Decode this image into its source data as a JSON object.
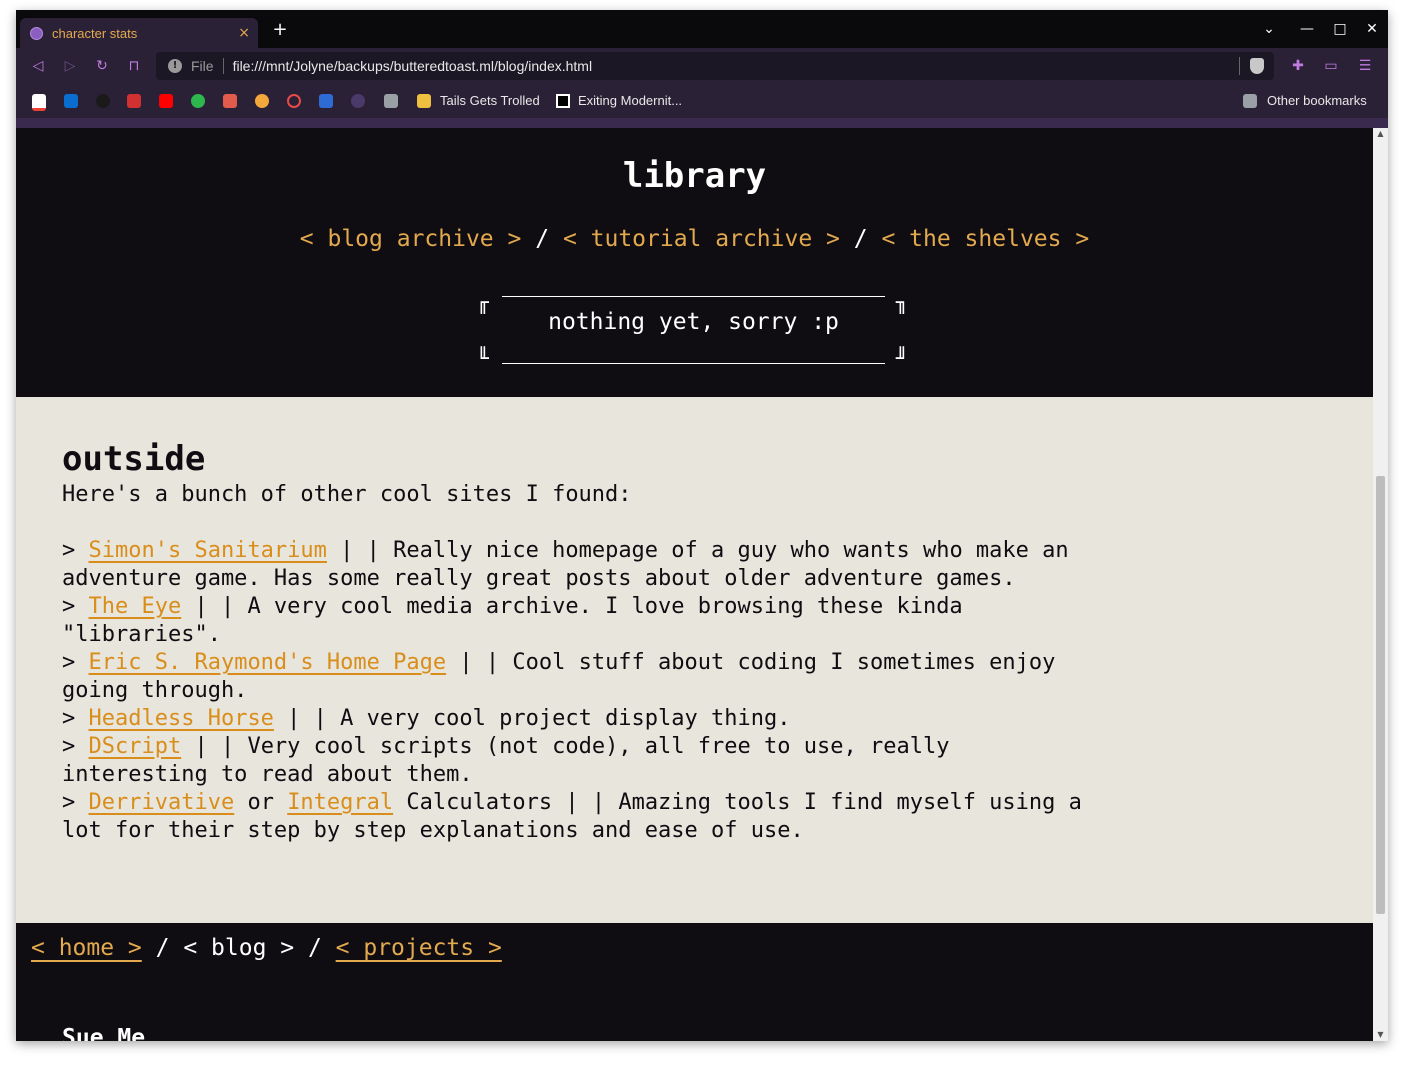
{
  "browser": {
    "tab_title": "character stats",
    "tab_close": "×",
    "new_tab": "+",
    "window": {
      "tab_search": "⌄",
      "minimize": "—",
      "maximize": "□",
      "close": "✕"
    },
    "url_scheme": "File",
    "url": "file:///mnt/Jolyne/backups/butteredtoast.ml/blog/index.html",
    "bookmarks": [
      {
        "label": "Tails Gets Trolled"
      },
      {
        "label": "Exiting Modernit..."
      },
      {
        "label": "Other bookmarks"
      }
    ],
    "accent_color": "#c07be0"
  },
  "hero": {
    "title": "library",
    "nav": [
      {
        "label": "< blog archive >"
      },
      {
        "label": "< tutorial archive >"
      },
      {
        "label": "< the shelves >"
      }
    ],
    "separator": "/",
    "box_text": "nothing yet, sorry :p",
    "corners": {
      "tl": "╓",
      "tr": "╖",
      "bl": "╙",
      "br": "╜"
    }
  },
  "outside": {
    "heading": "outside",
    "intro": "Here's a bunch of other cool sites I found:",
    "entries": [
      {
        "prefix": "> ",
        "link": "Simon's Sanitarium",
        "text": " | | Really nice homepage of a guy who wants who make an",
        "cont": "adventure game. Has some really great posts about older adventure games."
      },
      {
        "prefix": "> ",
        "link": "The Eye",
        "text": " | | A very cool media archive. I love browsing these kinda",
        "cont": "\"libraries\"."
      },
      {
        "prefix": "> ",
        "link": "Eric S. Raymond's Home Page",
        "text": " | | Cool stuff about coding I sometimes enjoy",
        "cont": "going through."
      },
      {
        "prefix": "> ",
        "link": "Headless Horse",
        "text": " | | A very cool project display thing.",
        "cont": ""
      },
      {
        "prefix": "> ",
        "link": "DScript",
        "text": " | | Very cool scripts (not code), all free to use, really",
        "cont": "interesting to read about them."
      }
    ],
    "last_entry": {
      "prefix": "> ",
      "link1": "Derrivative",
      "or": " or ",
      "link2": "Integral",
      "text": " Calculators | | Amazing tools I find myself using a",
      "cont": "lot for their step by step explanations and ease of use."
    },
    "link_color": "#d98e1c"
  },
  "footer": {
    "home": "< home >",
    "sep": " / ",
    "blog": "< blog >",
    "projects": "< projects >",
    "heading": "Sue Me"
  }
}
